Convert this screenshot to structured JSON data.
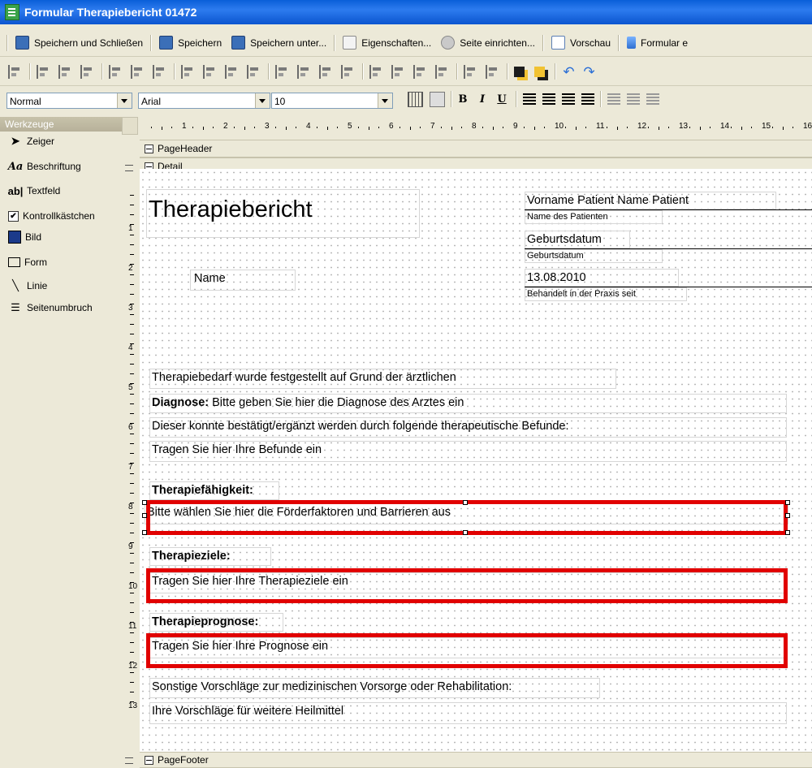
{
  "window": {
    "title": "Formular Therapiebericht 01472"
  },
  "toolbar": {
    "save_close": "Speichern und Schließen",
    "save": "Speichern",
    "save_as": "Speichern unter...",
    "properties": "Eigenschaften...",
    "page_setup": "Seite einrichten...",
    "preview": "Vorschau",
    "form_export": "Formular e"
  },
  "format": {
    "style": "Normal",
    "font": "Arial",
    "size": "10",
    "bold": "B",
    "italic": "I",
    "underline": "U"
  },
  "toolbox": {
    "header": "Werkzeuge",
    "items": [
      {
        "label": "Zeiger",
        "icon": "pointer-icon"
      },
      {
        "label": "Beschriftung",
        "icon": "label-icon"
      },
      {
        "label": "Textfeld",
        "icon": "textfield-icon"
      },
      {
        "label": "Kontrollkästchen",
        "icon": "checkbox-icon"
      },
      {
        "label": "Bild",
        "icon": "image-icon"
      },
      {
        "label": "Form",
        "icon": "shape-icon"
      },
      {
        "label": "Linie",
        "icon": "line-icon"
      },
      {
        "label": "Seitenumbruch",
        "icon": "pagebreak-icon"
      }
    ]
  },
  "ruler": {
    "horizontal": [
      "1",
      "2",
      "3",
      "4",
      "5",
      "6",
      "7",
      "8",
      "9",
      "10",
      "11",
      "12",
      "13",
      "14",
      "15",
      "16"
    ],
    "vertical": [
      "1",
      "2",
      "3",
      "4",
      "5",
      "6",
      "7",
      "8",
      "9",
      "10",
      "11",
      "12",
      "13"
    ]
  },
  "sections": {
    "header": "PageHeader",
    "detail": "Detail",
    "footer": "PageFooter"
  },
  "report": {
    "title": "Therapiebericht",
    "name_label": "Name",
    "patient_name": "Vorname Patient Name Patient",
    "patient_name_caption": "Name des Patienten",
    "birthdate": "Geburtsdatum",
    "birthdate_caption": "Geburtsdatum",
    "since_date": "13.08.2010",
    "since_caption": "Behandelt in der Praxis seit",
    "line1": "Therapiebedarf wurde festgestellt auf Grund der ärztlichen",
    "diagnosis_label": "Diagnose:",
    "diagnosis_text": "Bitte geben Sie hier die Diagnose des Arztes ein",
    "line3": "Dieser konnte bestätigt/ergänzt werden durch folgende therapeutische Befunde:",
    "findings": "Tragen Sie hier Ihre Befunde ein",
    "ability_heading": "Therapiefähigkeit:",
    "ability_text": "Bitte wählen Sie hier die Förderfaktoren und Barrieren aus",
    "goals_heading": "Therapieziele:",
    "goals_text": "Tragen Sie hier Ihre Therapieziele ein",
    "prognosis_heading": "Therapieprognose:",
    "prognosis_text": "Tragen Sie hier Ihre Prognose ein",
    "other_line": "Sonstige Vorschläge zur medizinischen Vorsorge oder Rehabilitation:",
    "other_text": "Ihre Vorschläge für weitere Heilmittel"
  },
  "highlight_color": "#e10000"
}
